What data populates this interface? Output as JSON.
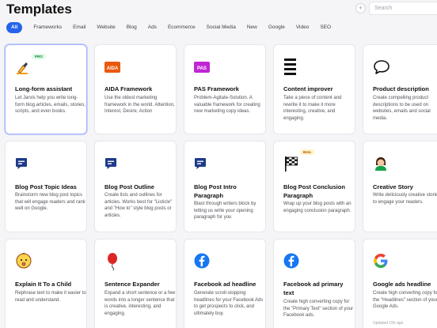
{
  "header": {
    "title": "Templates",
    "add_label": "+",
    "search_placeholder": "Search"
  },
  "filters": [
    "All",
    "Frameworks",
    "Email",
    "Website",
    "Blog",
    "Ads",
    "Ecommerce",
    "Social Media",
    "New",
    "Google",
    "Video",
    "SEO"
  ],
  "cards": [
    {
      "id": "long-form-assistant",
      "title": "Long-form assistant",
      "desc": "Let Jarvis help you write long-form blog articles, emails, stories, scripts, and even books.",
      "icon": "writing-hand-icon",
      "badge": "PRO"
    },
    {
      "id": "aida-framework",
      "title": "AIDA Framework",
      "desc": "Use the oldest marketing framework in the world. Attention, Interest, Desire, Action",
      "icon": "aida-logo-icon"
    },
    {
      "id": "pas-framework",
      "title": "PAS Framework",
      "desc": "Problem-Agitate-Solution. A valuable framework for creating new marketing copy ideas.",
      "icon": "pas-logo-icon"
    },
    {
      "id": "content-improver",
      "title": "Content improver",
      "desc": "Take a piece of content and rewrite it to make it more interesting, creative, and engaging.",
      "icon": "text-lines-icon"
    },
    {
      "id": "product-description",
      "title": "Product description",
      "desc": "Create compelling product descriptions to be used on websites, emails and social media.",
      "icon": "speech-bubble-icon"
    },
    {
      "id": "blog-post-topic-ideas",
      "title": "Blog Post Topic Ideas",
      "desc": "Brainstorm new blog post topics that will engage readers and rank well on Google.",
      "icon": "blog-chat-icon"
    },
    {
      "id": "blog-post-outline",
      "title": "Blog Post Outline",
      "desc": "Create lists and outlines for articles. Works best for \"Listicle\" and \"How to\" style blog posts or articles.",
      "icon": "blog-chat-icon"
    },
    {
      "id": "blog-post-intro-paragraph",
      "title": "Blog Post Intro Paragraph",
      "desc": "Blast through writers block by letting us write your opening paragraph for you",
      "icon": "blog-chat-icon"
    },
    {
      "id": "blog-post-conclusion-paragraph",
      "title": "Blog Post Conclusion Paragraph",
      "desc": "Wrap up your blog posts with an engaging conclusion paragraph.",
      "icon": "checkered-flag-icon",
      "badge": "Beta"
    },
    {
      "id": "creative-story",
      "title": "Creative Story",
      "desc": "Write deliciously creative stories to engage your readers.",
      "icon": "storyteller-icon"
    },
    {
      "id": "explain-it-to-a-child",
      "title": "Explain It To a Child",
      "desc": "Rephrase text to make it easier to read and understand.",
      "icon": "baby-face-icon"
    },
    {
      "id": "sentence-expander",
      "title": "Sentence Expander",
      "desc": "Expand a short sentence or a few words into a longer sentence that is creative, interesting, and engaging.",
      "icon": "balloon-icon"
    },
    {
      "id": "facebook-ad-headline",
      "title": "Facebook ad headline",
      "desc": "Generate scroll-stopping headlines for your Facebook Ads to get prospects to click, and ultimately buy.",
      "icon": "facebook-icon"
    },
    {
      "id": "facebook-ad-primary-text",
      "title": "Facebook ad primary text",
      "desc": "Create high converting copy for the \"Primary Text\" section of your Facebook ads.",
      "icon": "facebook-icon"
    },
    {
      "id": "google-ads-headline",
      "title": "Google ads headline",
      "desc": "Create high converting copy for the \"Headlines\" section of your Google Ads.",
      "icon": "google-icon",
      "updated": "Updated 15h ago"
    }
  ],
  "colors": {
    "accent": "#2563eb",
    "facebook": "#1877f2",
    "blog_icon": "#1e3a8a"
  }
}
